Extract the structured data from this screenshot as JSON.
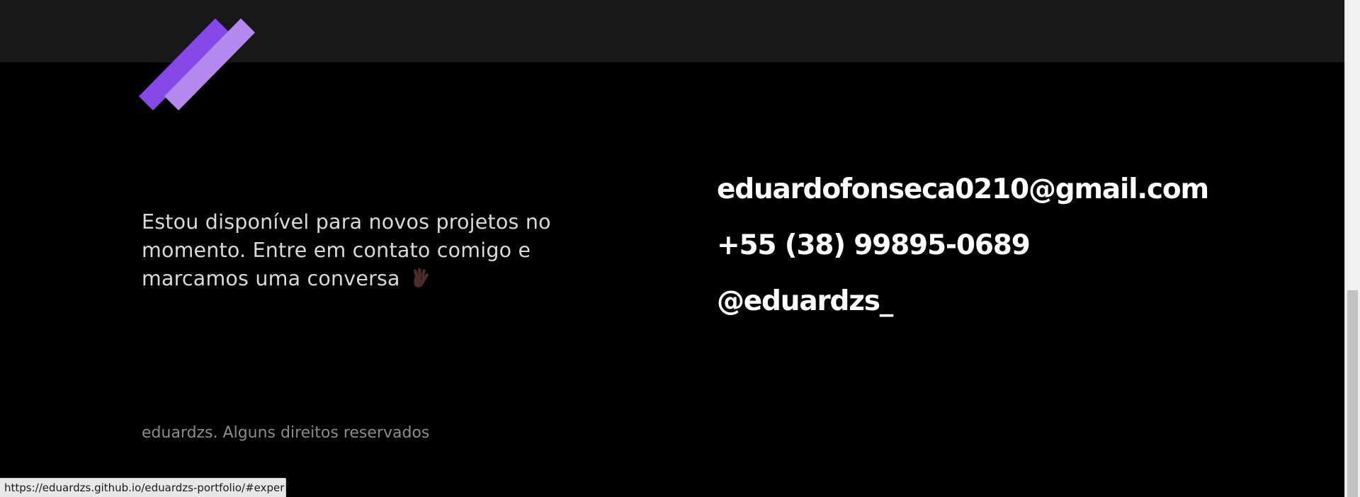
{
  "about": {
    "text": "Estou disponível para novos projetos no momento. Entre em contato comigo e marcamos uma conversa",
    "emoji_icon": "vulcan-salute-icon"
  },
  "contacts": [
    {
      "label": "eduardofonseca0210@gmail.com"
    },
    {
      "label": "+55 (38) 99895-0689"
    },
    {
      "label": "@eduardzs_"
    }
  ],
  "footer": {
    "copyright": "eduardzs. Alguns direitos reservados"
  },
  "status_bar": {
    "url": "https://eduardzs.github.io/eduardzs-portfolio/#experiencia"
  },
  "scrollbar": {
    "position": 1.0
  },
  "colors": {
    "background": "#000000",
    "top_band": "#181818",
    "logo_primary": "#8748e8",
    "logo_secondary": "#b48af0",
    "text_primary": "#ffffff",
    "text_secondary": "#d9d9d9",
    "text_muted": "#8c8c8c"
  },
  "icons": {
    "logo": "double-slash-logo",
    "hand": "vulcan-salute-icon"
  }
}
